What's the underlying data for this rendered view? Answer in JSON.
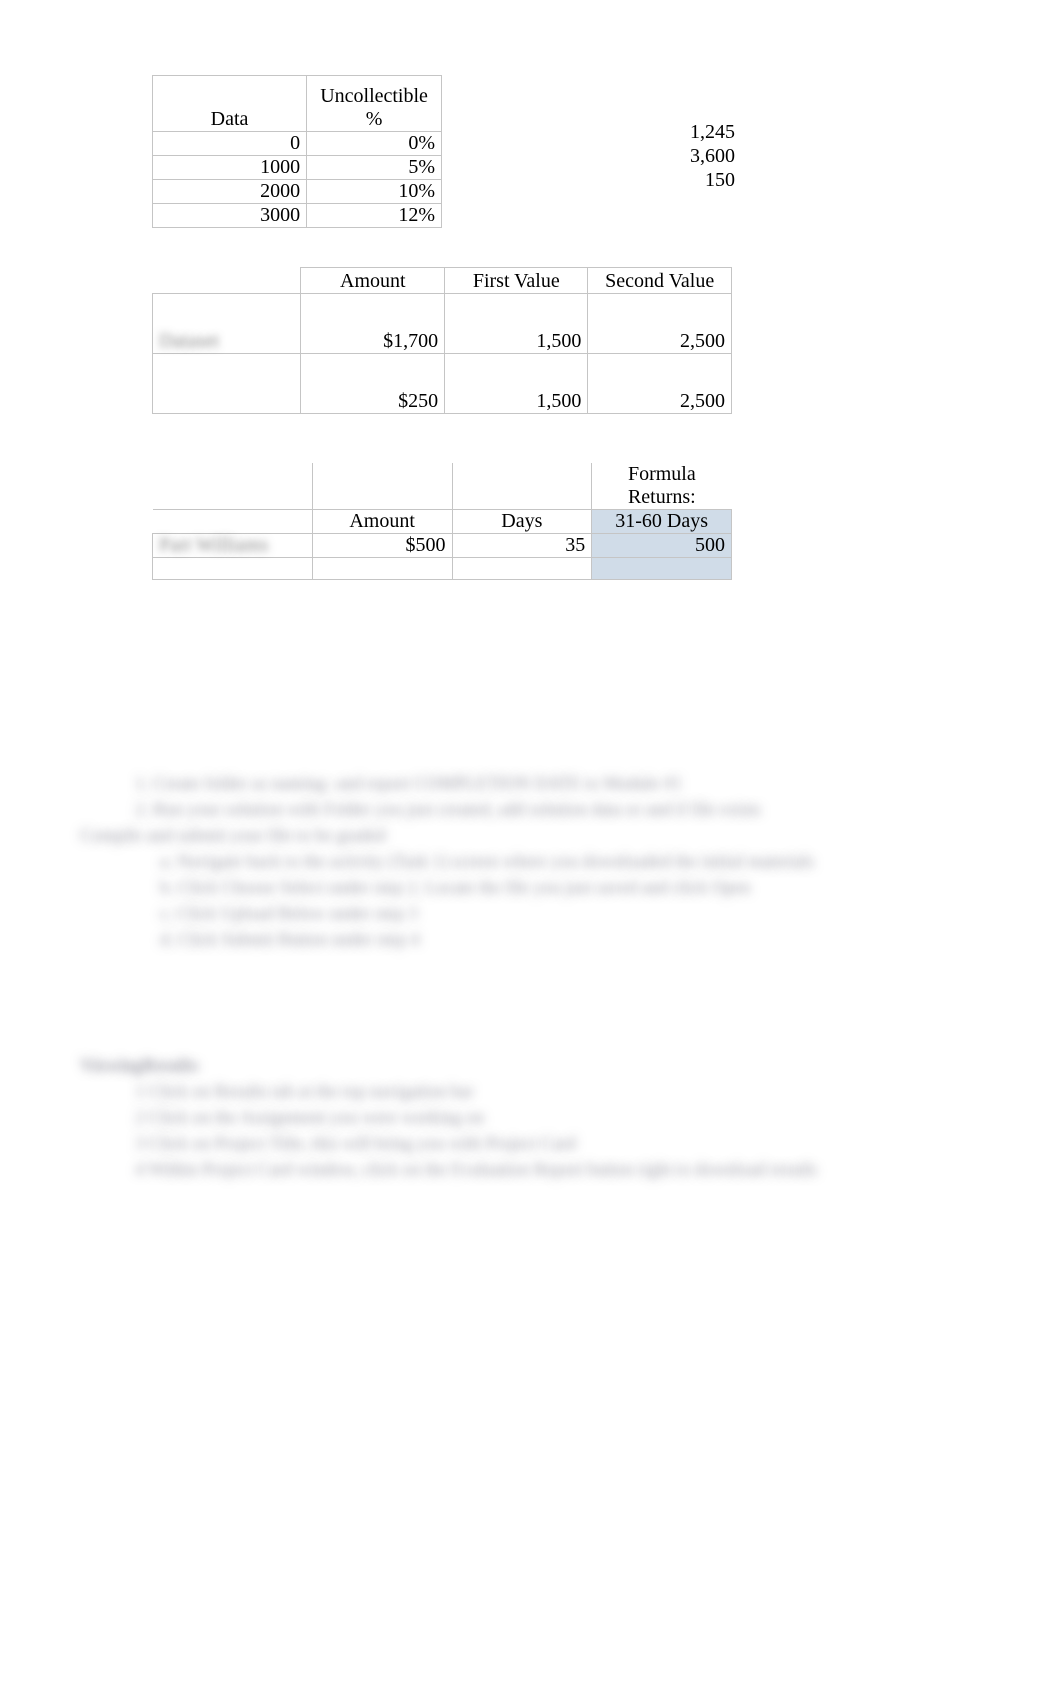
{
  "table1": {
    "headers": {
      "h1": "Data",
      "h2": "Uncollectible  %"
    },
    "rows": [
      {
        "data": "0",
        "pct": "0%"
      },
      {
        "data": "1000",
        "pct": "5%"
      },
      {
        "data": "2000",
        "pct": "10%"
      },
      {
        "data": "3000",
        "pct": "12%"
      }
    ]
  },
  "side_numbers": [
    "1,245",
    "3,600",
    "150"
  ],
  "table2": {
    "headers": {
      "h_amount": "Amount",
      "h_first": "First Value",
      "h_second": "Second Value"
    },
    "rows": [
      {
        "label": "Dataset",
        "amount": "$1,700",
        "first": "1,500",
        "second": "2,500"
      },
      {
        "label": "",
        "amount": "$250",
        "first": "1,500",
        "second": "2,500"
      }
    ]
  },
  "table3": {
    "top_label": "Formula Returns:",
    "headers": {
      "h_amount": "Amount",
      "h_days": "Days",
      "h_range": "31-60 Days"
    },
    "rows": [
      {
        "label": "Part Williams",
        "amount": "$500",
        "days": "35",
        "result": "500"
      },
      {
        "label": "",
        "amount": "",
        "days": "",
        "result": ""
      }
    ]
  },
  "blurred": {
    "l1": "1.  Create folder as naming-  and report COMPLETION DATE to  Module  #1",
    "l2": "2.  Run your solution with Folder you just created, add solution data or and if file exists",
    "l3": "Compile and submit your file to be graded",
    "l4": "a.  Navigate back to the activity (Task 1) screen where you downloaded the initial materials",
    "l5": "b.  Click Choose Select under step 2. Locate the file you just saved and click Open",
    "l6": "c.  Click Upload Below under step 3",
    "l7": "d.  Click Submit Button under step 4",
    "heading": "ViewingResults",
    "r1": "1 Click on Results tab at the top navigation bar",
    "r2": "2 Click on the Assignment you were working on",
    "r3": "3 Click on Project Title, this will bring you with Project Card",
    "r4": "4 Within Project Card window, click on the Evaluation Report button right to download resutls"
  }
}
